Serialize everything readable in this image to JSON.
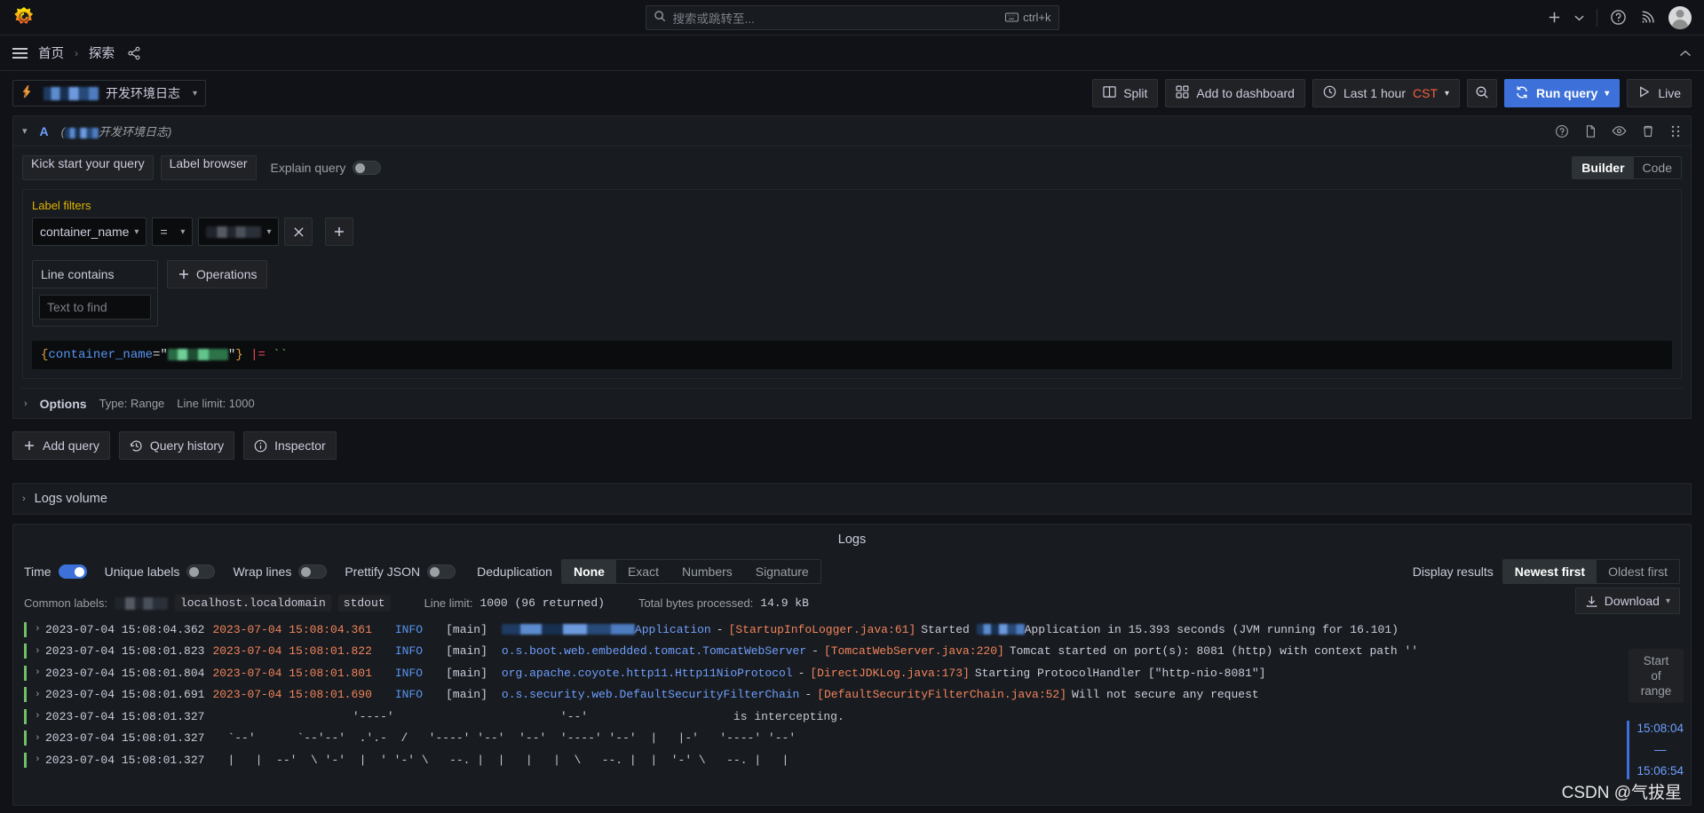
{
  "topnav": {
    "logo_icon": "grafana-logo-icon",
    "search_placeholder": "搜索或跳转至...",
    "search_icon": "search-icon",
    "shortcut_label": "ctrl+k",
    "keyboard_icon": "keyboard-icon",
    "add_icon": "plus-icon",
    "add_caret_icon": "chevron-down-icon",
    "help_icon": "help-circle-icon",
    "news_icon": "rss-icon",
    "profile_icon": "user-avatar-icon"
  },
  "breadcrumb": {
    "menu_icon": "hamburger-menu-icon",
    "items": [
      "首页",
      "探索"
    ],
    "separator": "›",
    "share_icon": "share-nodes-icon",
    "dock_icon": "chevron-up-icon"
  },
  "toolbar": {
    "datasource_icon": "loki-datasource-icon",
    "datasource_redacted": true,
    "datasource_name": "开发环境日志",
    "datasource_caret": "chevron-down-icon",
    "split_label": "Split",
    "split_icon": "columns-icon",
    "add_to_dashboard_label": "Add to dashboard",
    "add_to_dashboard_icon": "apps-grid-icon",
    "time_range_label": "Last 1 hour",
    "timezone_label": "CST",
    "clock_icon": "clock-icon",
    "zoom_out_icon": "search-minus-icon",
    "run_query_label": "Run query",
    "run_query_icon": "sync-icon",
    "live_label": "Live",
    "live_icon": "play-icon"
  },
  "query_row": {
    "collapse_icon": "chevron-down-icon",
    "ref_id": "A",
    "datasource_hint_prefix": "(",
    "datasource_hint_name": "开发环境日志",
    "datasource_hint_suffix": ")",
    "icons": [
      "help-circle-icon",
      "copy-icon",
      "eye-icon",
      "trash-icon",
      "drag-handle-icon"
    ]
  },
  "query_editor": {
    "kick_start_label": "Kick start your query",
    "label_browser_label": "Label browser",
    "explain_query_label": "Explain query",
    "explain_query_on": false,
    "mode_builder_label": "Builder",
    "mode_code_label": "Code",
    "mode_active": "Builder",
    "label_filters_title": "Label filters",
    "filter_label": "container_name",
    "filter_operator": "=",
    "filter_value_redacted": true,
    "remove_filter_icon": "close-icon",
    "add_filter_icon": "plus-icon",
    "line_contains_title": "Line contains",
    "line_contains_placeholder": "Text to find",
    "line_contains_value": "",
    "operations_label": "Operations",
    "operations_icon": "plus-icon",
    "expression": {
      "open_brace": "{",
      "label": "container_name",
      "equals": "=\"",
      "value_redacted": true,
      "close_quote": "\"",
      "close_brace": "}",
      "pipe": "|=",
      "arg": "``"
    },
    "options_chevron": "chevron-right-icon",
    "options_label": "Options",
    "options_type": "Type: Range",
    "options_line_limit": "Line limit: 1000"
  },
  "query_actions": {
    "add_query_label": "Add query",
    "add_query_icon": "plus-icon",
    "query_history_label": "Query history",
    "query_history_icon": "history-icon",
    "inspector_label": "Inspector",
    "inspector_icon": "info-circle-icon"
  },
  "logs_volume": {
    "chevron_icon": "chevron-right-icon",
    "title": "Logs volume"
  },
  "logs_panel": {
    "title": "Logs",
    "options": [
      {
        "label": "Time",
        "on": true
      },
      {
        "label": "Unique labels",
        "on": false
      },
      {
        "label": "Wrap lines",
        "on": false
      },
      {
        "label": "Prettify JSON",
        "on": false
      }
    ],
    "deduplication_label": "Deduplication",
    "deduplication_options": [
      "None",
      "Exact",
      "Numbers",
      "Signature"
    ],
    "deduplication_active": "None",
    "display_results_label": "Display results",
    "order_options": [
      "Newest first",
      "Oldest first"
    ],
    "order_active": "Newest first",
    "common_labels_label": "Common labels:",
    "common_label_redacted": true,
    "common_labels": [
      "localhost.localdomain",
      "stdout"
    ],
    "line_limit_label": "Line limit:",
    "line_limit_value": "1000 (96 returned)",
    "bytes_label": "Total bytes processed:",
    "bytes_value": "14.9 kB",
    "download_label": "Download",
    "download_icon": "download-icon",
    "download_caret": "chevron-down-icon",
    "range_box_lines": [
      "Start",
      "of",
      "range"
    ],
    "time_indicator": {
      "start": "15:08:04",
      "dash": "—",
      "end": "15:06:54"
    }
  },
  "log_rows": [
    {
      "expand_icon": "chevron-right-icon",
      "ts1": "2023-07-04 15:08:04.362",
      "ts2": "2023-07-04 15:08:04.361",
      "level": "INFO",
      "thread": "[main]",
      "logger_redacted": true,
      "logger": "Application",
      "src": "[StartupInfoLogger.java:61]",
      "msg_pre": "Started ",
      "msg_redacted": true,
      "msg": "Application in 15.393 seconds (JVM running for 16.101)",
      "kind": "java"
    },
    {
      "expand_icon": "chevron-right-icon",
      "ts1": "2023-07-04 15:08:01.823",
      "ts2": "2023-07-04 15:08:01.822",
      "level": "INFO",
      "thread": "[main]",
      "logger": "o.s.boot.web.embedded.tomcat.TomcatWebServer",
      "src": "[TomcatWebServer.java:220]",
      "msg": "Tomcat started on port(s): 8081 (http) with context path ''",
      "kind": "java"
    },
    {
      "expand_icon": "chevron-right-icon",
      "ts1": "2023-07-04 15:08:01.804",
      "ts2": "2023-07-04 15:08:01.801",
      "level": "INFO",
      "thread": "[main]",
      "logger": "org.apache.coyote.http11.Http11NioProtocol",
      "src": "[DirectJDKLog.java:173]",
      "msg": "Starting ProtocolHandler [\"http-nio-8081\"]",
      "kind": "java"
    },
    {
      "expand_icon": "chevron-right-icon",
      "ts1": "2023-07-04 15:08:01.691",
      "ts2": "2023-07-04 15:08:01.690",
      "level": "INFO",
      "thread": "[main]",
      "logger": "o.s.security.web.DefaultSecurityFilterChain",
      "src": "[DefaultSecurityFilterChain.java:52]",
      "msg": "Will not secure any request",
      "kind": "java"
    },
    {
      "expand_icon": "chevron-right-icon",
      "ts1": "2023-07-04 15:08:01.327",
      "art": "                  '----'                        '--'                     is intercepting.",
      "kind": "art"
    },
    {
      "expand_icon": "chevron-right-icon",
      "ts1": "2023-07-04 15:08:01.327",
      "art": "`--'      `--'--'  .'.-  /   '----' '--'  '--'  '----' '--'  |   |-'   '----' '--'",
      "kind": "art"
    },
    {
      "expand_icon": "chevron-right-icon",
      "ts1": "2023-07-04 15:08:01.327",
      "art": "|   |  --'  \\ '-'  |  ' '-' \\   --. |  |   |   |  \\   --. |  |  '-' \\   --. |   |",
      "kind": "art"
    }
  ],
  "watermark": "CSDN @气拔星",
  "colors": {
    "accent_blue": "#3d71d9",
    "link_blue": "#6e9fff",
    "orange": "#f2845c",
    "green": "#73bf69",
    "yellow": "#e0b400",
    "cst_orange": "#f55f3e",
    "panel_bg": "#181b1f",
    "page_bg": "#111217"
  }
}
